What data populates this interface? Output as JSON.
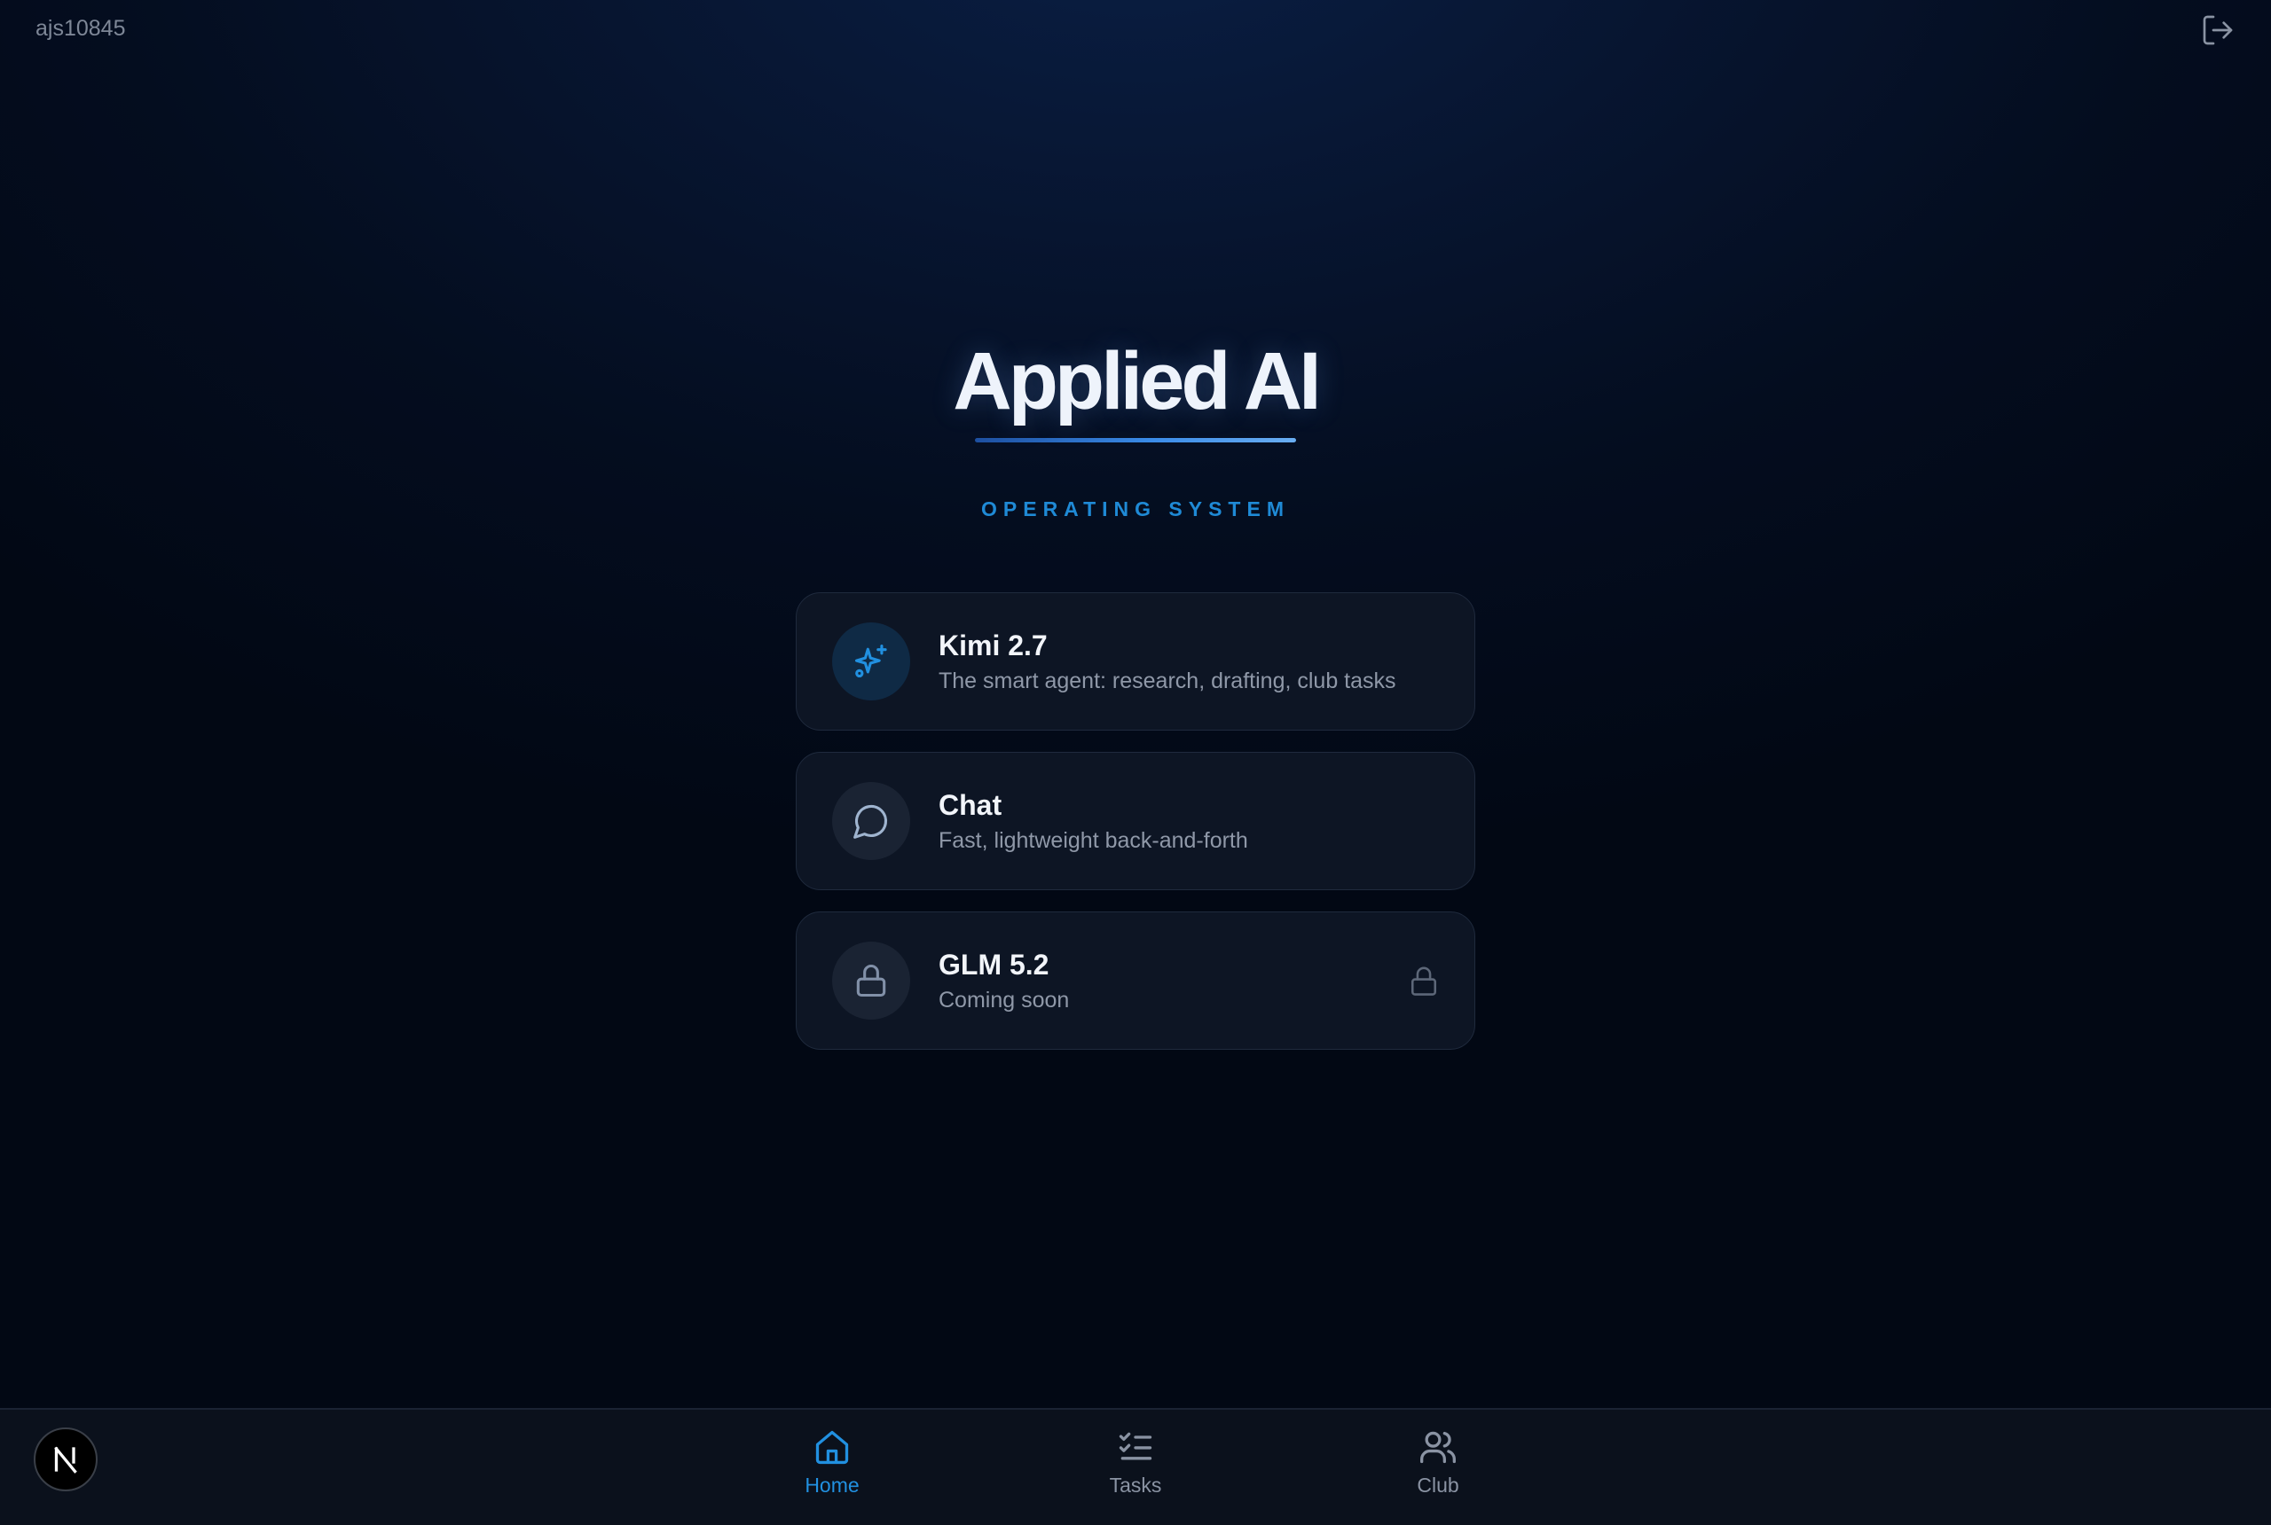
{
  "header": {
    "username": "ajs10845",
    "logout_icon": "log-out-icon"
  },
  "hero": {
    "title": "Applied AI",
    "subtitle": "OPERATING SYSTEM"
  },
  "cards": [
    {
      "title": "Kimi 2.7",
      "description": "The smart agent: research, drafting, club tasks",
      "icon": "sparkles-icon",
      "locked": false
    },
    {
      "title": "Chat",
      "description": "Fast, lightweight back-and-forth",
      "icon": "message-circle-icon",
      "locked": false
    },
    {
      "title": "GLM 5.2",
      "description": "Coming soon",
      "icon": "lock-icon",
      "locked": true
    }
  ],
  "bottom_nav": {
    "badge_icon": "n-logo-icon",
    "items": [
      {
        "label": "Home",
        "icon": "home-icon",
        "active": true
      },
      {
        "label": "Tasks",
        "icon": "list-checks-icon",
        "active": false
      },
      {
        "label": "Club",
        "icon": "users-icon",
        "active": false
      }
    ]
  },
  "colors": {
    "accent": "#2190e0",
    "background": "#040d1f",
    "card_background": "#0d1524",
    "muted_text": "#8f98a8"
  }
}
